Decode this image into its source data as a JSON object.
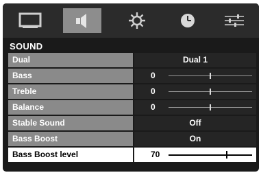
{
  "tabs": [
    {
      "name": "picture-tab",
      "icon": "monitor-icon",
      "active": false
    },
    {
      "name": "sound-tab",
      "icon": "speaker-icon",
      "active": true
    },
    {
      "name": "setup-tab",
      "icon": "gear-icon",
      "active": false
    },
    {
      "name": "timer-tab",
      "icon": "clock-icon",
      "active": false
    },
    {
      "name": "options-tab",
      "icon": "sliders-icon",
      "active": false
    }
  ],
  "section_title": "SOUND",
  "rows": [
    {
      "label": "Dual",
      "value": "Dual 1"
    },
    {
      "label": "Bass",
      "value": "0",
      "level": 0.5
    },
    {
      "label": "Treble",
      "value": "0",
      "level": 0.5
    },
    {
      "label": "Balance",
      "value": "0",
      "level": 0.5
    },
    {
      "label": "Stable Sound",
      "value": "Off"
    },
    {
      "label": "Bass Boost",
      "value": "On"
    },
    {
      "label": "Bass Boost level",
      "value": "70",
      "level": 0.7
    }
  ],
  "selected_row": "Bass Boost level",
  "colors": {
    "background": "#1a1a1a",
    "label_bg": "#8a8a8a",
    "selected_bg": "#ffffff",
    "active_tab": "#8d8d8d"
  }
}
